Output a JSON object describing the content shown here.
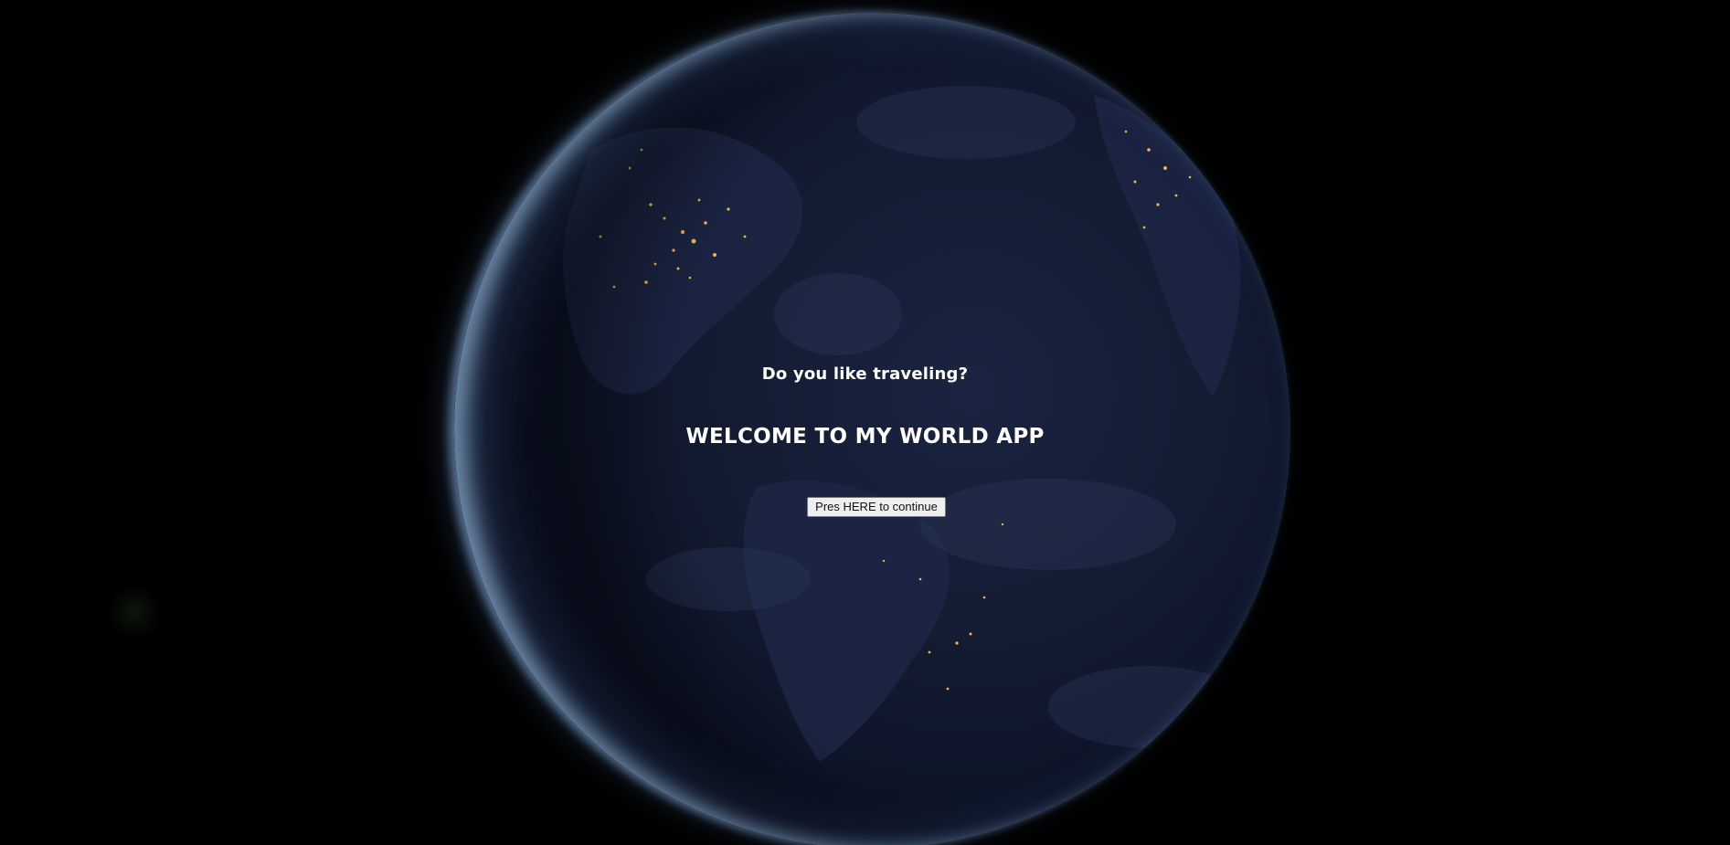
{
  "page": {
    "background_color": "#000000"
  },
  "hero": {
    "background_image": "earth-at-night-globe",
    "tagline": "Do you like traveling?",
    "headline": "WELCOME TO MY WORLD APP",
    "continue_button_label": "Pres HERE to continue"
  },
  "colors": {
    "text": "#ffffff",
    "button_bg": "#efefef",
    "city_lights": "#f5b44a"
  }
}
